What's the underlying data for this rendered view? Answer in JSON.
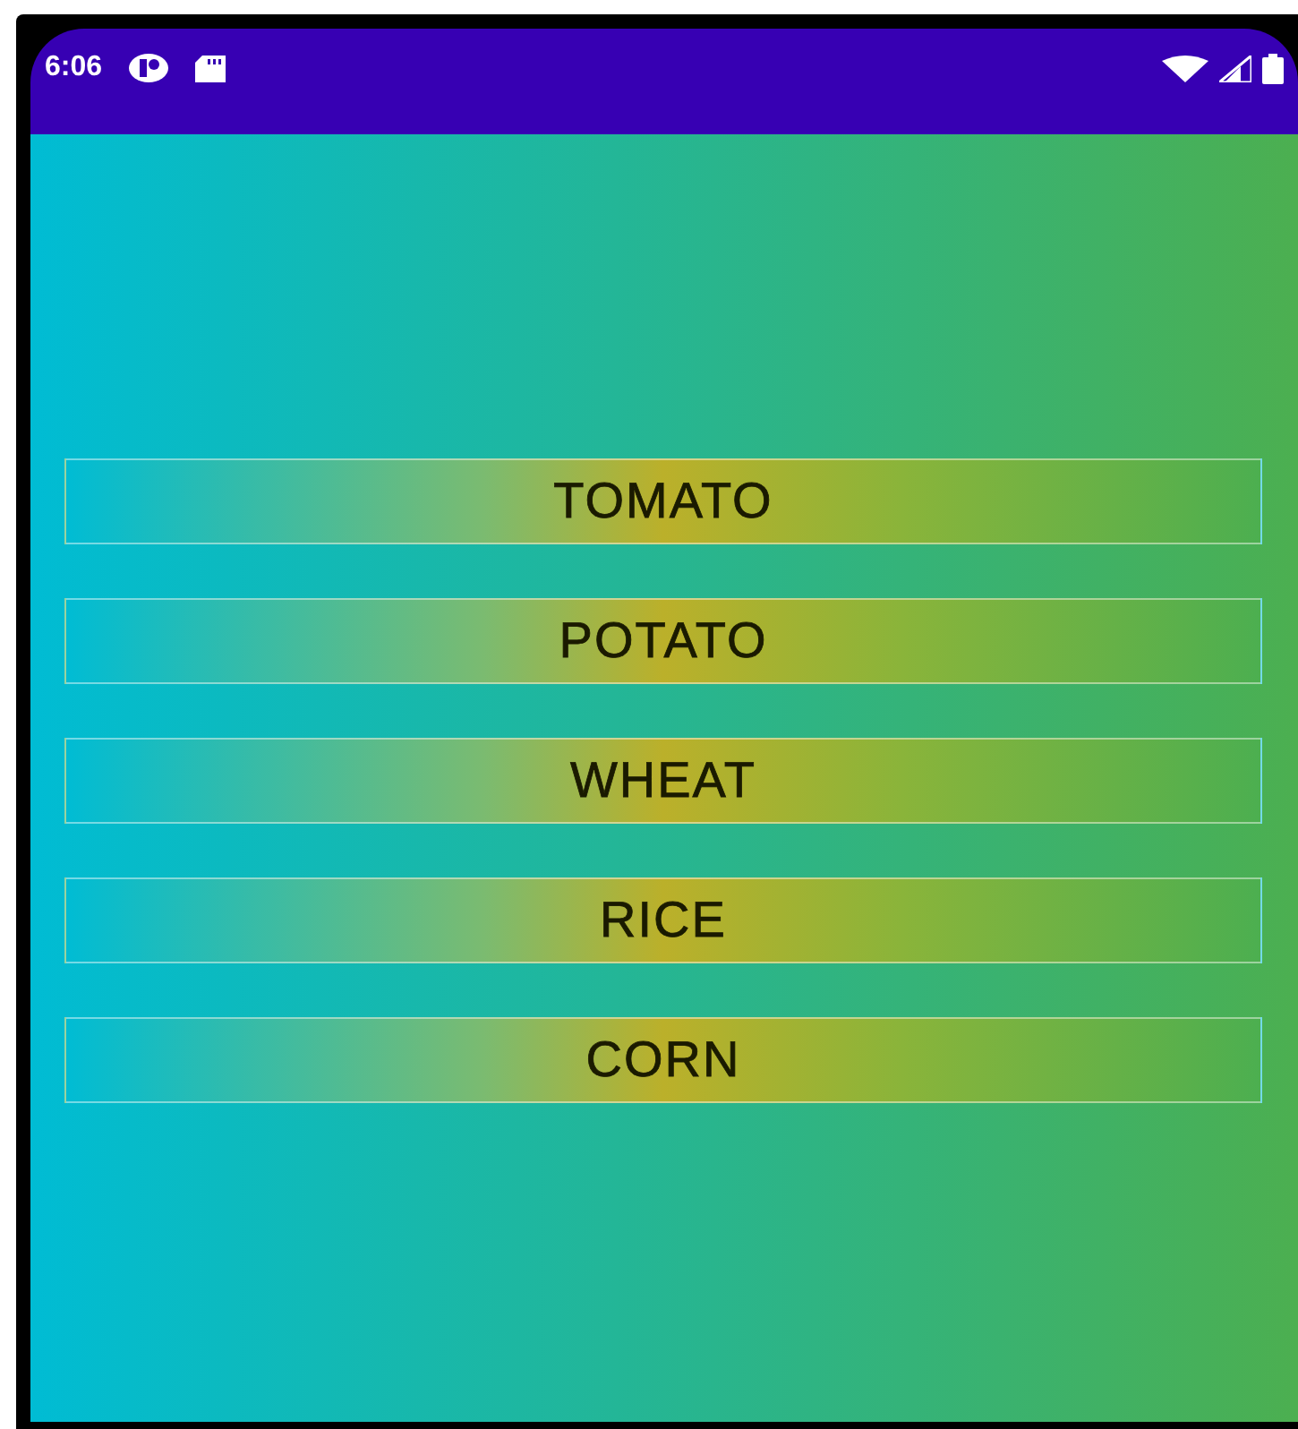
{
  "status_bar": {
    "time": "6:06"
  },
  "buttons": [
    "TOMATO",
    "POTATO",
    "WHEAT",
    "RICE",
    "CORN"
  ]
}
